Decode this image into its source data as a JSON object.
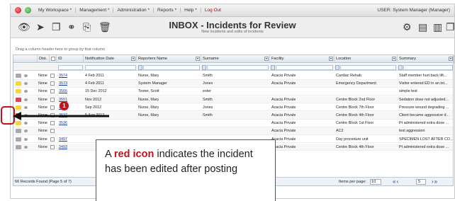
{
  "menubar": {
    "items": [
      "My Workspace *",
      "Management *",
      "Administration *",
      "Reports *",
      "Help *",
      "Log Out"
    ],
    "user": "USER: System Manager (Manager)"
  },
  "toolbar": {
    "title": "INBOX - Incidents for Review",
    "subtitle": "New incidents and edits of incidents"
  },
  "grid": {
    "group_hint": "Drag a column header here to group by that column",
    "columns": [
      "Dist.",
      "ID",
      "Notification Date",
      "Reporters Name",
      "Surname",
      "Facility",
      "Location",
      "Summary"
    ],
    "rows": [
      {
        "mark": "grey",
        "dist": "None",
        "id": "3574",
        "date": "4 Feb 2011",
        "name": "Nurse, Mary",
        "surname": "Smith",
        "facility": "Acacia Private",
        "location": "Cardiac Rehab",
        "summary": "Staff member hurt back lift..."
      },
      {
        "mark": "yellow",
        "dist": "None",
        "id": "3573",
        "date": "4 Feb 2011",
        "name": "System Manager",
        "surname": "Jones",
        "facility": "Acacia Private",
        "location": "Emergency Department",
        "summary": "Visitor entered ED in an int..."
      },
      {
        "mark": "yellow",
        "dist": "None",
        "id": "3566",
        "date": "15 Dec 2012",
        "name": "Tester, Scott",
        "surname": "ester",
        "facility": "",
        "location": "",
        "summary": "simple test"
      },
      {
        "mark": "red",
        "dist": "None",
        "id": "3551",
        "date": "Nov 2012",
        "name": "Nurse, Mary",
        "surname": "Smith",
        "facility": "Acacia Private",
        "location": "Centre Block 2nd Floor",
        "summary": "Sedation dose not adjusted..."
      },
      {
        "mark": "yellow",
        "dist": "None",
        "id": "3545",
        "date": "Sep 2012",
        "name": "Nurse, Mary",
        "surname": "Jones",
        "facility": "Acacia Private",
        "location": "Centre Block 7th Floor",
        "summary": "Pressure wound degrading ..."
      },
      {
        "mark": "red",
        "dist": "None",
        "id": "3537",
        "date": "5 Aug 2012",
        "name": "Nurse, Mary",
        "surname": "Smith",
        "facility": "Acacia Private",
        "location": "Centre Block 4th Floor",
        "summary": "Client became aggressive d..."
      },
      {
        "mark": "yellow",
        "dist": "None",
        "id": "3536",
        "date": "",
        "name": "",
        "surname": "",
        "facility": "Acacia Private",
        "location": "Centre Block 1st Floor",
        "summary": "Pt administered extra dose ..."
      },
      {
        "mark": "grey",
        "dist": "None",
        "id": "",
        "date": "",
        "name": "",
        "surname": "",
        "facility": "Acacia Private",
        "location": "AC2",
        "summary": "test aggression"
      },
      {
        "mark": "grey",
        "dist": "None",
        "id": "3497",
        "date": "",
        "name": "",
        "surname": "",
        "facility": "Acacia Private",
        "location": "Day procedure unit",
        "summary": "SPECIMEN LOST AFTER CO..."
      },
      {
        "mark": "grey",
        "dist": "None",
        "id": "3493",
        "date": "",
        "name": "",
        "surname": "",
        "facility": "Acacia Private",
        "location": "Centre Block 4th Floor",
        "summary": "Pt administered extra dose ..."
      }
    ],
    "footer": {
      "records": "66 Records Found (Page 5 of 7)",
      "items_per_page_label": "Items per page:",
      "items_per_page": "10",
      "page": "5"
    }
  },
  "annotation": {
    "number": "1",
    "pre": "A ",
    "highlight": "red icon",
    "post": " indicates the incident has been edited after posting"
  },
  "colors": {
    "accent_red": "#c0101a",
    "link_blue": "#1a3d9a"
  }
}
